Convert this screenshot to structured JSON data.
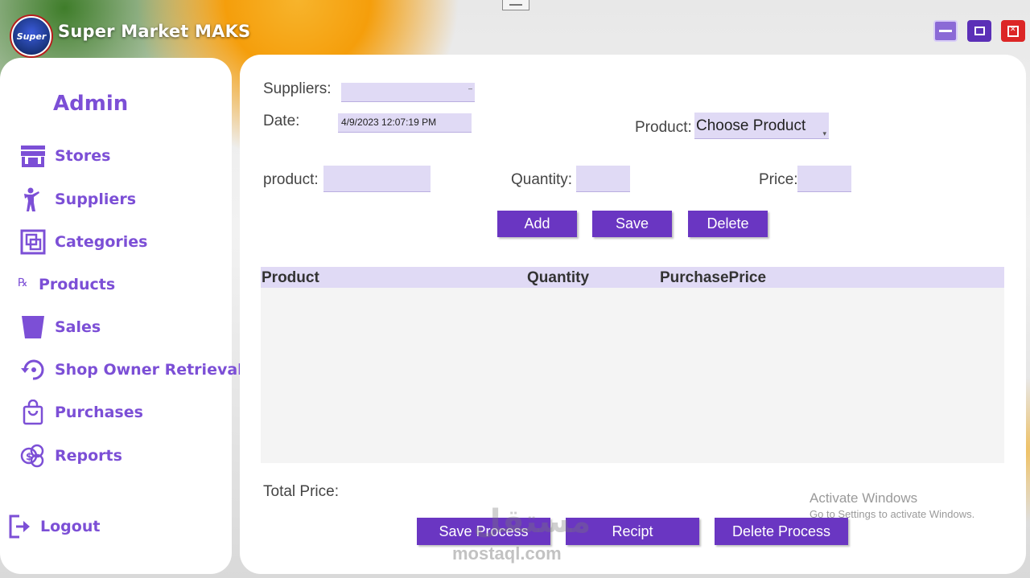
{
  "window": {
    "title": "Super Market MAKS",
    "logo_text": "Super",
    "controls": [
      "minimize-icon",
      "maximize-icon",
      "close-icon"
    ]
  },
  "sidebar": {
    "title": "Admin",
    "items": [
      {
        "label": "Stores",
        "icon": "store-icon"
      },
      {
        "label": "Suppliers",
        "icon": "person-icon"
      },
      {
        "label": "Categories",
        "icon": "categories-icon"
      },
      {
        "label": "Products",
        "icon": "rx-icon"
      },
      {
        "label": "Sales",
        "icon": "bucket-icon"
      },
      {
        "label": "Shop Owner Retrieval",
        "icon": "restore-icon"
      },
      {
        "label": "Purchases",
        "icon": "shopping-bag-icon"
      },
      {
        "label": "Reports",
        "icon": "money-report-icon"
      }
    ],
    "logout_label": "Logout"
  },
  "form": {
    "suppliers_label": "Suppliers:",
    "suppliers_value": "",
    "date_label": "Date:",
    "date_value": "4/9/2023 12:07:19 PM",
    "product_combo_label": "Product:",
    "product_combo_value": "Choose Product",
    "product_label": "product:",
    "product_value": "",
    "quantity_label": "Quantity:",
    "quantity_value": "",
    "price_label": "Price:",
    "price_value": ""
  },
  "actions": {
    "add": "Add",
    "save": "Save",
    "delete": "Delete"
  },
  "grid": {
    "columns": [
      "Product",
      "Quantity",
      "PurchasePrice"
    ],
    "rows": []
  },
  "footer": {
    "total_label": "Total Price:",
    "total_value": "",
    "save_process": "Save Process",
    "recipt": "Recipt",
    "delete_process": "Delete Process"
  },
  "overlay": {
    "activate_title": "Activate Windows",
    "activate_sub": "Go to Settings to activate Windows.",
    "watermark": "mostaql.com",
    "watermark_ar": "مستقل"
  },
  "colors": {
    "accent": "#6a36c2",
    "nav_text": "#7c4fd6",
    "field_bg": "#e0daf5",
    "close_red": "#dc2626"
  }
}
